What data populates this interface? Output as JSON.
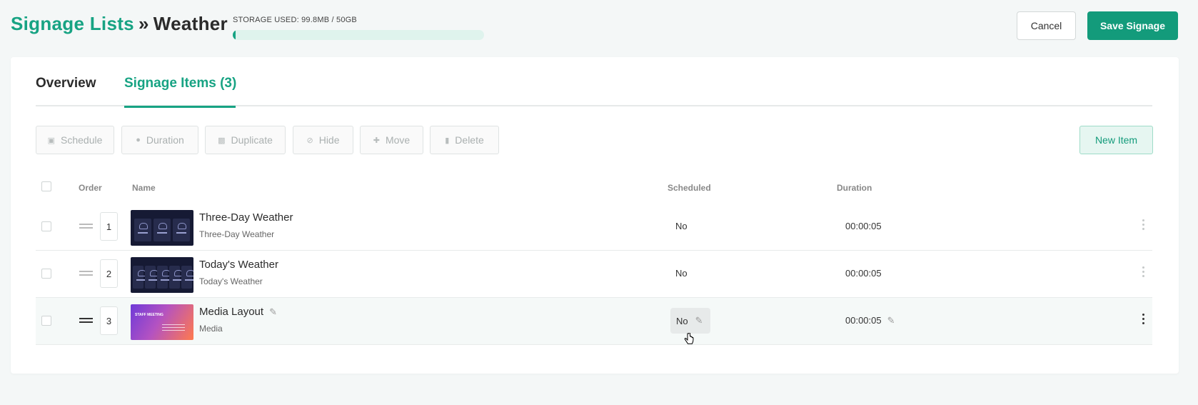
{
  "header": {
    "breadcrumb_parent": "Signage Lists",
    "breadcrumb_sep": "»",
    "breadcrumb_current": "Weather",
    "storage_label": "STORAGE USED: 99.8MB / 50GB",
    "storage_fraction": 0.002,
    "cancel_label": "Cancel",
    "save_label": "Save Signage"
  },
  "tabs": [
    {
      "label": "Overview",
      "active": false
    },
    {
      "label": "Signage Items (3)",
      "active": true
    }
  ],
  "toolbar": {
    "schedule": "Schedule",
    "duration": "Duration",
    "duplicate": "Duplicate",
    "hide": "Hide",
    "move": "Move",
    "delete": "Delete",
    "new_item": "New Item"
  },
  "table": {
    "columns": {
      "order": "Order",
      "name": "Name",
      "scheduled": "Scheduled",
      "duration": "Duration"
    },
    "rows": [
      {
        "order": "1",
        "name": "Three-Day Weather",
        "type": "Three-Day Weather",
        "scheduled": "No",
        "duration": "00:00:05",
        "thumb": "weather-3"
      },
      {
        "order": "2",
        "name": "Today's Weather",
        "type": "Today's Weather",
        "scheduled": "No",
        "duration": "00:00:05",
        "thumb": "weather-5"
      },
      {
        "order": "3",
        "name": "Media Layout",
        "type": "Media",
        "scheduled": "No",
        "duration": "00:00:05",
        "thumb": "media",
        "thumb_text": "STAFF MEETING"
      }
    ]
  },
  "colors": {
    "accent": "#17a383",
    "primary_button": "#139b7b"
  }
}
